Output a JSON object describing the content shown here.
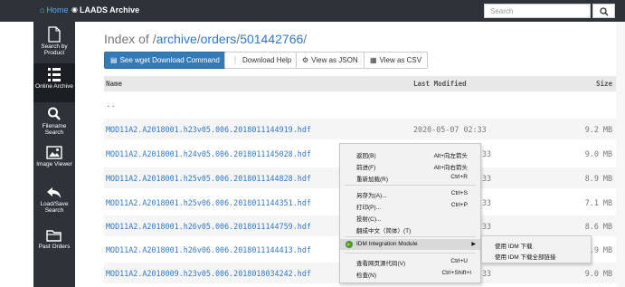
{
  "header": {
    "home_label": "Home",
    "archive_label": "LAADS Archive",
    "search_placeholder": "Search"
  },
  "sidebar": {
    "items": [
      {
        "label": "Search by Product",
        "icon": "file-icon"
      },
      {
        "label": "Online Archive",
        "icon": "list-icon",
        "active": true
      },
      {
        "label": "Filename Search",
        "icon": "search-icon"
      },
      {
        "label": "Image Viewer",
        "icon": "image-icon"
      },
      {
        "label": "Load/Save Search",
        "icon": "share-icon"
      },
      {
        "label": "Past Orders",
        "icon": "folder-icon"
      }
    ]
  },
  "page": {
    "title_prefix": "Index of /",
    "path_parts": [
      "archive",
      "orders",
      "501442766"
    ],
    "buttons": {
      "wget": "See wget Download Command",
      "help": "Download Help",
      "json": "View as JSON",
      "csv": "View as CSV"
    }
  },
  "table": {
    "headers": {
      "name": "Name",
      "modified": "Last Modified",
      "size": "Size"
    },
    "parent": "..",
    "rows": [
      {
        "name": "MOD11A2.A2018001.h23v05.006.2018011144919.hdf",
        "modified": "2020-05-07 02:33",
        "size": "9.2 MB"
      },
      {
        "name": "MOD11A2.A2018001.h24v05.006.2018011145028.hdf",
        "modified": "33",
        "size": "9.0 MB"
      },
      {
        "name": "MOD11A2.A2018001.h25v05.006.2018011144828.hdf",
        "modified": "33",
        "size": "8.9 MB"
      },
      {
        "name": "MOD11A2.A2018001.h25v06.006.2018011144351.hdf",
        "modified": "33",
        "size": "7.1 MB"
      },
      {
        "name": "MOD11A2.A2018001.h26v05.006.2018011144759.hdf",
        "modified": "33",
        "size": "8.6 MB"
      },
      {
        "name": "MOD11A2.A2018001.h26v06.006.2018011144413.hdf",
        "modified": "33",
        "size": "7.9 MB"
      },
      {
        "name": "MOD11A2.A2018009.h23v05.006.2018018034242.hdf",
        "modified": "33",
        "size": "9.0 MB"
      }
    ]
  },
  "context_menu": {
    "items": [
      {
        "label": "返回(B)",
        "shortcut": "Alt+向左箭头"
      },
      {
        "label": "前进(F)",
        "shortcut": "Alt+向右箭头"
      },
      {
        "label": "重新加载(R)",
        "shortcut": "Ctrl+R"
      },
      {
        "label": "另存为(A)...",
        "shortcut": "Ctrl+S"
      },
      {
        "label": "打印(P)...",
        "shortcut": "Ctrl+P"
      },
      {
        "label": "投射(C)...",
        "shortcut": ""
      },
      {
        "label": "翻成中文（简体）(T)",
        "shortcut": ""
      },
      {
        "label": "IDM Integration Module",
        "shortcut": ""
      },
      {
        "label": "查看网页源代码(V)",
        "shortcut": "Ctrl+U"
      },
      {
        "label": "检查(N)",
        "shortcut": "Ctrl+Shift+I"
      }
    ],
    "submenu": [
      "使用 IDM 下载",
      "使用 IDM 下载全部链接"
    ]
  },
  "colors": {
    "accent": "#337ab7",
    "link": "#3178c6",
    "sidebar": "#2d3339"
  }
}
